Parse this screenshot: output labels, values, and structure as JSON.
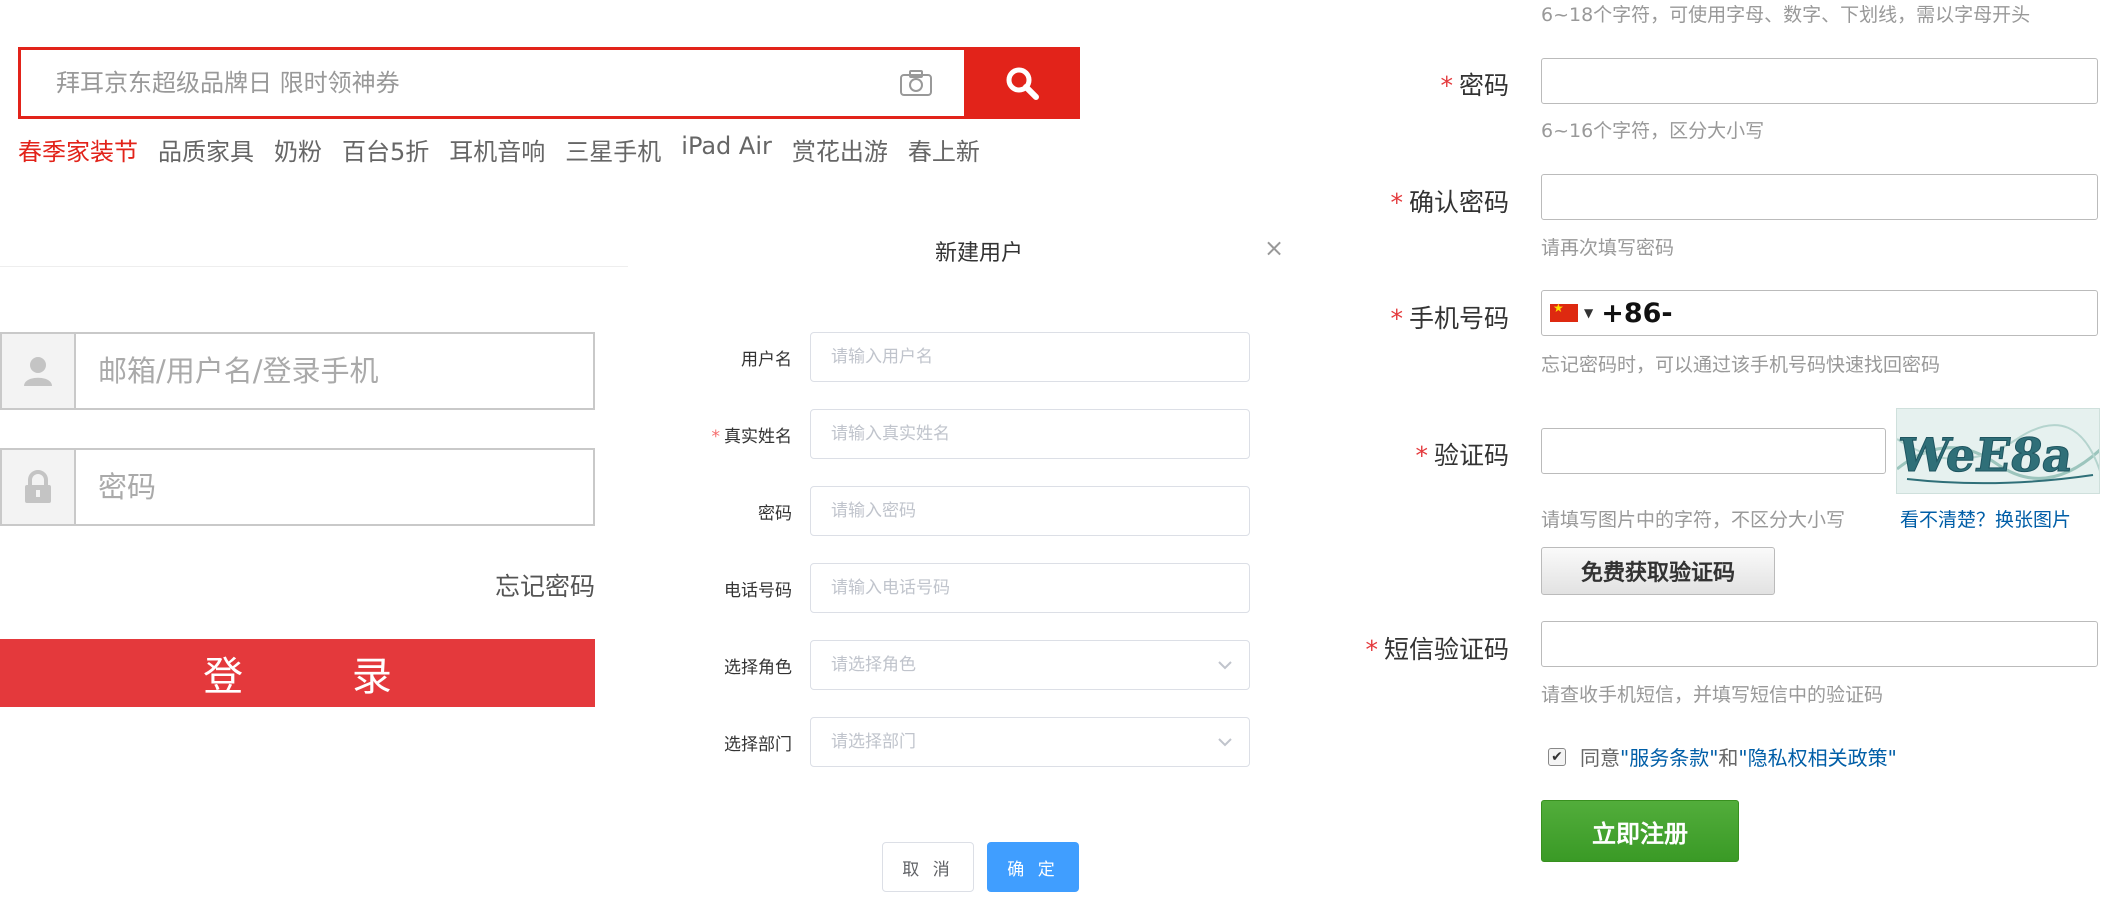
{
  "search": {
    "placeholder": "拜耳京东超级品牌日 限时领神券",
    "hot_words": [
      "春季家装节",
      "品质家具",
      "奶粉",
      "百台5折",
      "耳机音响",
      "三星手机",
      "iPad Air",
      "赏花出游",
      "春上新"
    ],
    "accent_color": "#e2231a"
  },
  "login": {
    "username_placeholder": "邮箱/用户名/登录手机",
    "password_placeholder": "密码",
    "forgot_password": "忘记密码",
    "login_button": "登 录",
    "button_color": "#e4393c"
  },
  "dialog": {
    "title": "新建用户",
    "close": "×",
    "fields": [
      {
        "label": "用户名",
        "required": false,
        "placeholder": "请输入用户名"
      },
      {
        "label": "真实姓名",
        "required": true,
        "placeholder": "请输入真实姓名"
      },
      {
        "label": "密码",
        "required": false,
        "placeholder": "请输入密码"
      },
      {
        "label": "电话号码",
        "required": false,
        "placeholder": "请输入电话号码"
      },
      {
        "label": "选择角色",
        "required": false,
        "placeholder": "请选择角色"
      },
      {
        "label": "选择部门",
        "required": false,
        "placeholder": "请选择部门"
      }
    ],
    "cancel": "取 消",
    "confirm": "确 定",
    "primary_color": "#409eff"
  },
  "register": {
    "username_hint": "6~18个字符，可使用字母、数字、下划线，需以字母开头",
    "password_label": "密码",
    "password_hint": "6~16个字符，区分大小写",
    "confirm_label": "确认密码",
    "confirm_hint": "请再次填写密码",
    "phone_label": "手机号码",
    "phone_prefix": "+86-",
    "phone_hint": "忘记密码时，可以通过该手机号码快速找回密码",
    "captcha_label": "验证码",
    "captcha_text": "WeE8a",
    "captcha_hint": "请填写图片中的字符，不区分大小写",
    "captcha_refresh": "看不清楚？换张图片",
    "sms_button": "免费获取验证码",
    "sms_label": "短信验证码",
    "sms_hint": "请查收手机短信，并填写短信中的验证码",
    "agree_prefix": "同意",
    "terms_link": "\"服务条款\"",
    "and": "和",
    "privacy_link": "\"隐私权相关政策\"",
    "register_button": "立即注册",
    "required_mark": "*"
  }
}
